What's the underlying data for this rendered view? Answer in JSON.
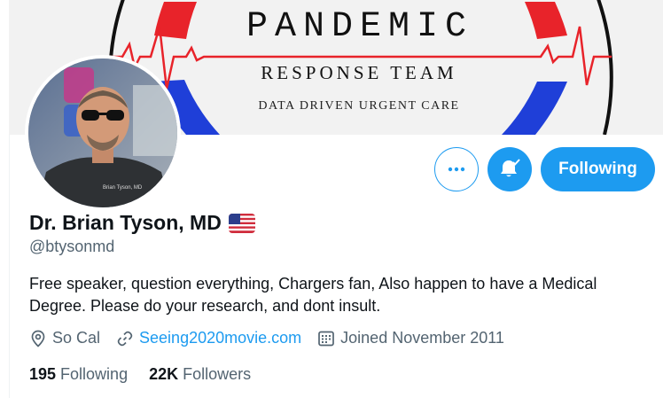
{
  "banner": {
    "title": "PANDEMIC",
    "subtitle": "RESPONSE TEAM",
    "tagline": "DATA DRIVEN URGENT CARE"
  },
  "avatar": {
    "shirt_text": "Brian Tyson, MD"
  },
  "actions": {
    "more_icon": "more-horizontal-icon",
    "bell_icon": "bell-subscribed-icon",
    "follow_label": "Following"
  },
  "profile": {
    "name": "Dr. Brian Tyson, MD",
    "flag_icon": "us-flag-icon",
    "handle": "@btysonmd",
    "bio": "Free speaker, question everything, Chargers fan, Also happen to have a Medical Degree. Please do your research, and dont insult."
  },
  "meta": {
    "location": "So Cal",
    "website": "Seeing2020movie.com",
    "joined": "Joined November 2011"
  },
  "stats": {
    "following_count": "195",
    "following_label": "Following",
    "followers_count": "22K",
    "followers_label": "Followers"
  },
  "colors": {
    "accent": "#1d9bf0",
    "banner_red": "#e8232a",
    "banner_blue": "#1f3fd8",
    "secondary_text": "#536471"
  }
}
